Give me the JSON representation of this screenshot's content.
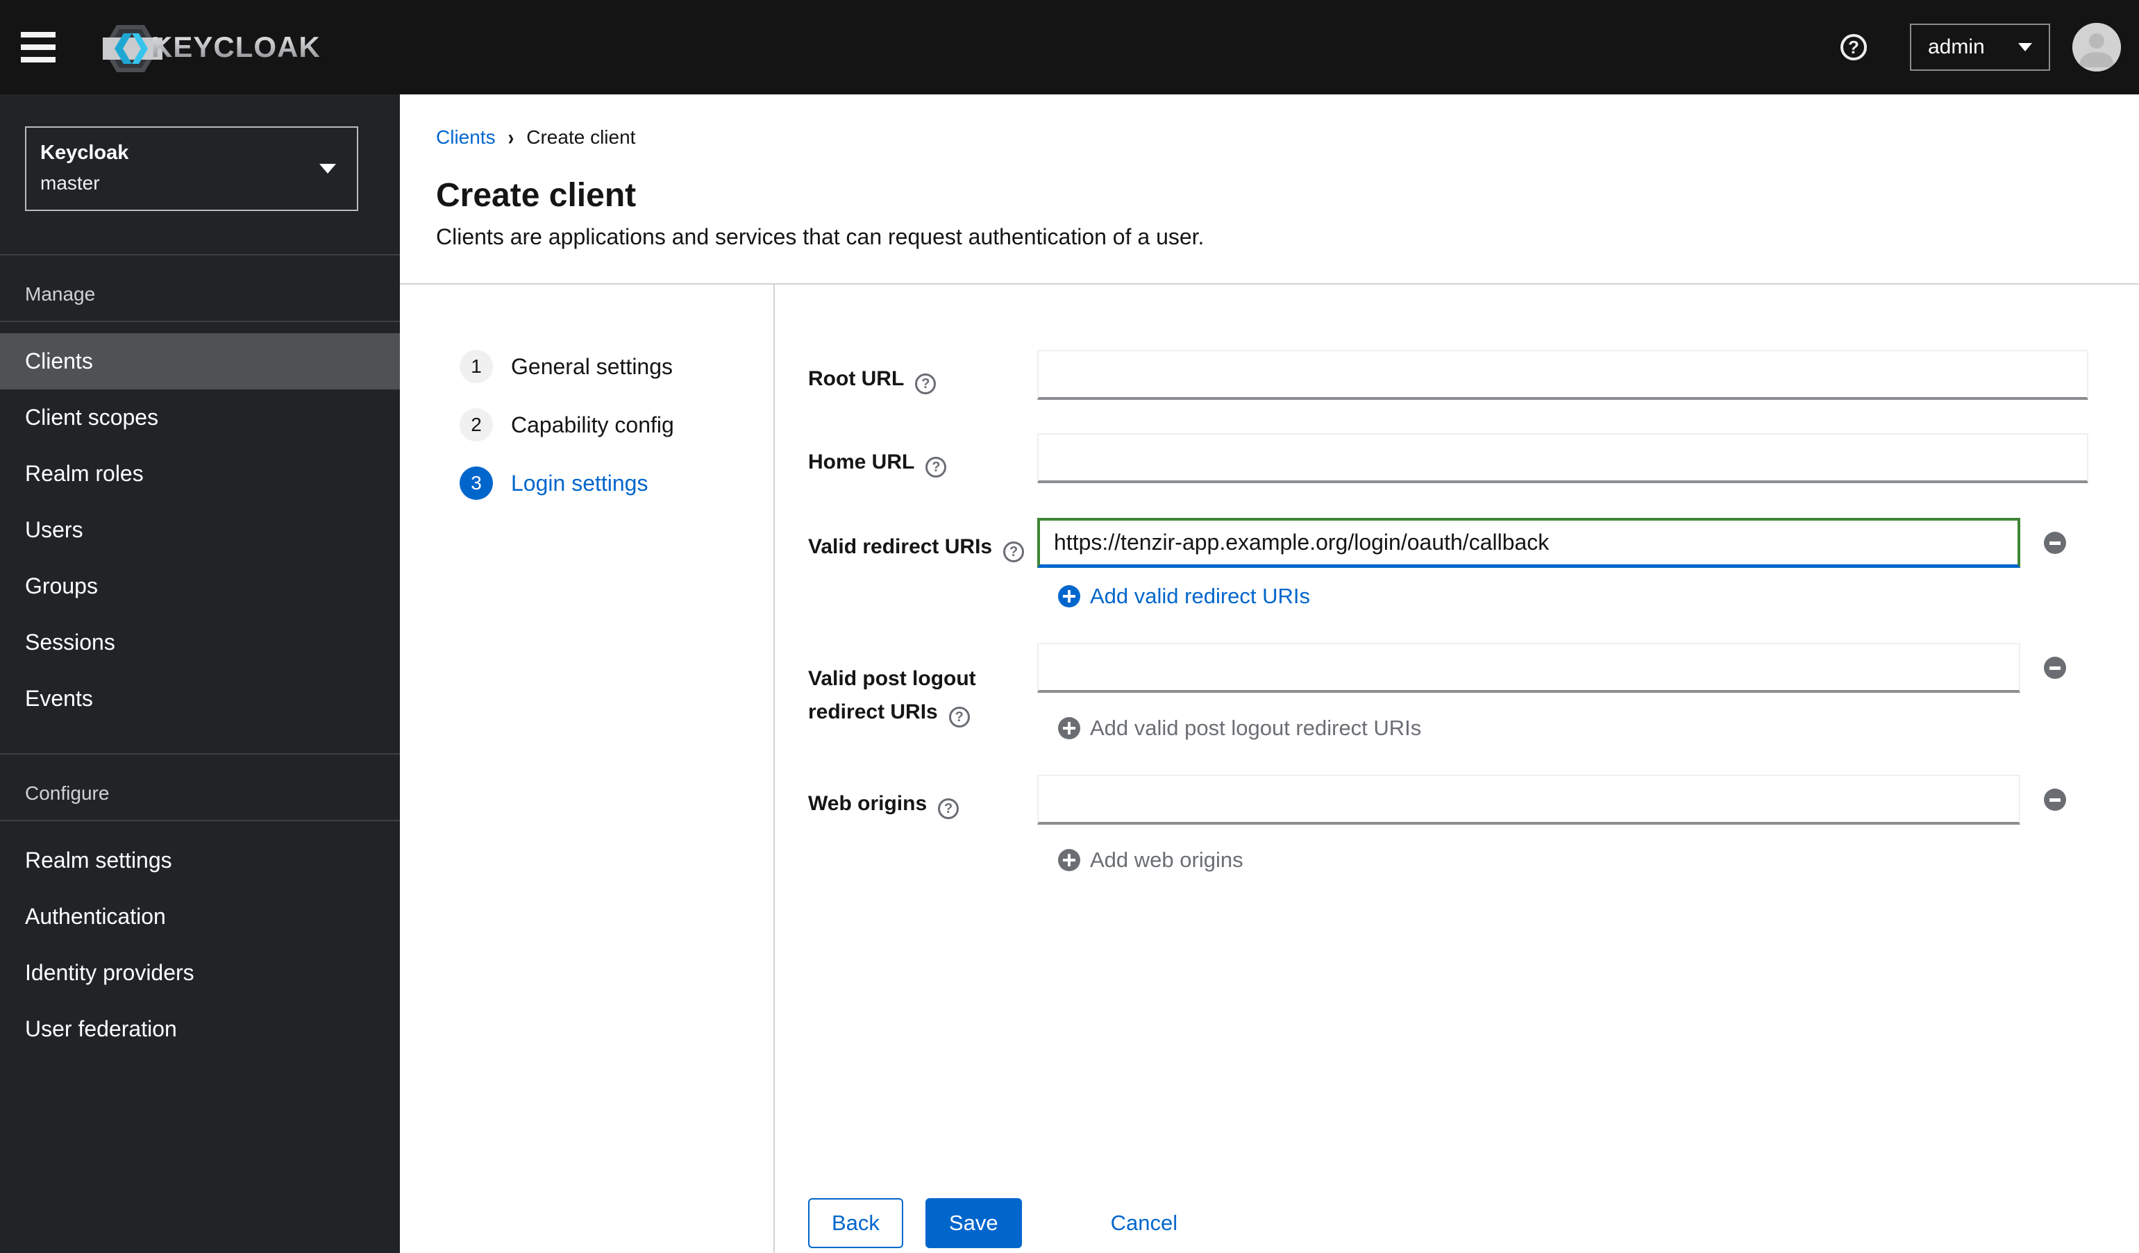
{
  "masthead": {
    "brand": "KEYCLOAK",
    "user": "admin",
    "help": "?"
  },
  "sidebar": {
    "realm": {
      "name": "Keycloak",
      "sub": "master"
    },
    "sections": [
      {
        "heading": "Manage",
        "items": [
          "Clients",
          "Client scopes",
          "Realm roles",
          "Users",
          "Groups",
          "Sessions",
          "Events"
        ],
        "current": "Clients"
      },
      {
        "heading": "Configure",
        "items": [
          "Realm settings",
          "Authentication",
          "Identity providers",
          "User federation"
        ]
      }
    ]
  },
  "breadcrumb": {
    "parent": "Clients",
    "current": "Create client"
  },
  "page": {
    "title": "Create client",
    "subtitle": "Clients are applications and services that can request authentication of a user."
  },
  "wizard": {
    "steps": [
      {
        "num": "1",
        "label": "General settings",
        "active": false
      },
      {
        "num": "2",
        "label": "Capability config",
        "active": false
      },
      {
        "num": "3",
        "label": "Login settings",
        "active": true
      }
    ]
  },
  "form": {
    "root_url": {
      "label": "Root URL",
      "value": ""
    },
    "home_url": {
      "label": "Home URL",
      "value": ""
    },
    "redirect": {
      "label": "Valid redirect URIs",
      "value": "https://tenzir-app.example.org/login/oauth/callback",
      "add_label": "Add valid redirect URIs"
    },
    "post_logout": {
      "label_line1": "Valid post logout",
      "label_line2": "redirect URIs",
      "value": "",
      "add_label": "Add valid post logout redirect URIs"
    },
    "web_origins": {
      "label": "Web origins",
      "value": "",
      "add_label": "Add web origins"
    }
  },
  "footer": {
    "back": "Back",
    "save": "Save",
    "cancel": "Cancel"
  },
  "colors": {
    "accent_blue": "#0066cc",
    "success_green": "#3e8635",
    "masthead_bg": "#141414",
    "sidebar_bg": "#212427",
    "selected_bg": "#4f5255"
  }
}
